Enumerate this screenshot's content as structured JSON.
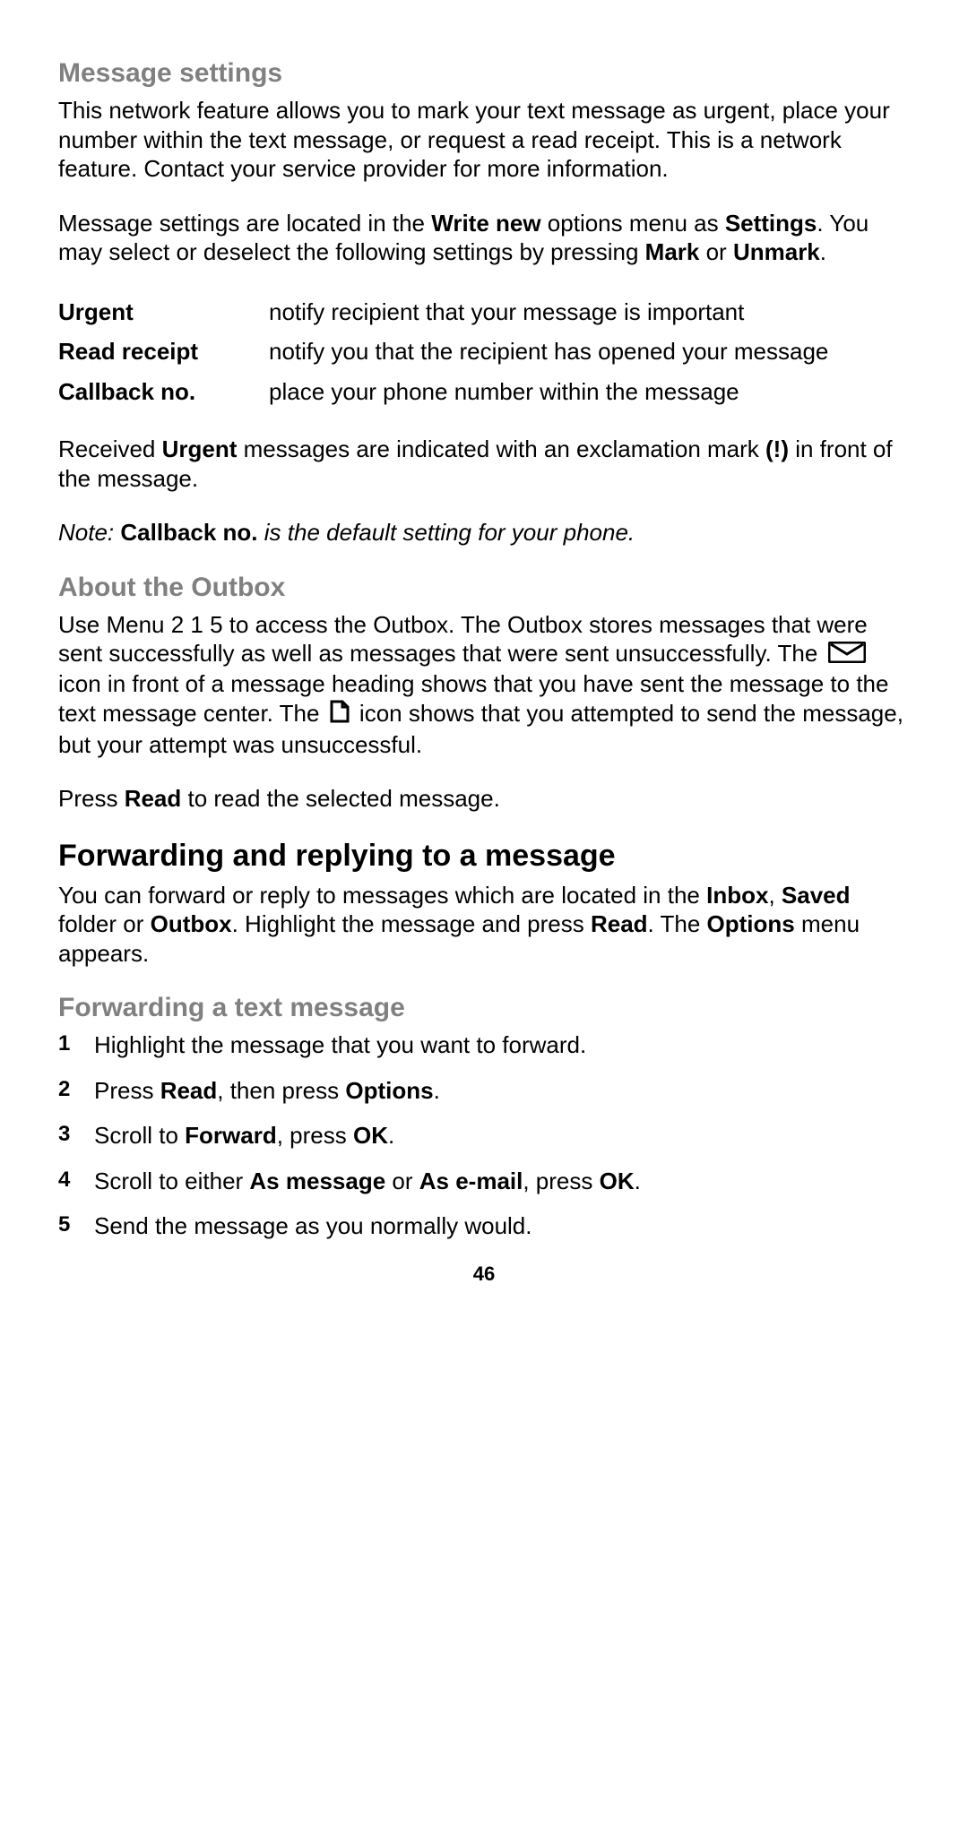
{
  "section1": {
    "heading": "Message settings",
    "p1": "This network feature allows you to mark your text message as urgent, place your number within the text message, or request a read receipt.  This is a network feature. Contact your service provider for more information.",
    "p2_pre": "Message settings are located in the ",
    "p2_b1": "Write new",
    "p2_mid1": " options menu as ",
    "p2_b2": "Settings",
    "p2_mid2": ". You may select or deselect the following settings by pressing ",
    "p2_b3": "Mark",
    "p2_mid3": " or ",
    "p2_b4": "Unmark",
    "p2_end": ".",
    "table": [
      {
        "term": "Urgent",
        "def": "notify recipient that your message is important"
      },
      {
        "term": "Read receipt",
        "def": "notify you that the recipient has opened your message"
      },
      {
        "term": "Callback no.",
        "def": "place your phone number within the message"
      }
    ],
    "p3_pre": "Received ",
    "p3_b1": "Urgent",
    "p3_mid": " messages are indicated with an exclamation mark ",
    "p3_paren": "(!)",
    "p3_end": " in front of the message.",
    "note_prefix": "Note: ",
    "note_bold": "Callback no.",
    "note_rest": " is the default setting for your phone."
  },
  "section2": {
    "heading": "About the Outbox",
    "p1_a": "Use Menu 2 1 5 to access the Outbox. The Outbox stores messages that were sent successfully as well as messages that were sent unsuccessfully. The ",
    "p1_b": " icon in front of a message heading shows that you have sent the message to the text message center. The ",
    "p1_c": " icon shows that you attempted to send the message, but your attempt was unsuccessful.",
    "p2_pre": "Press ",
    "p2_b": "Read",
    "p2_end": " to read the selected message."
  },
  "section3": {
    "heading": "Forwarding and replying to a message",
    "p1_pre": "You can forward or reply to messages which are located in the ",
    "p1_b1": "Inbox",
    "p1_m1": ", ",
    "p1_b2": "Saved",
    "p1_m2": " folder or ",
    "p1_b3": "Outbox",
    "p1_m3": ".  Highlight the message and press ",
    "p1_b4": "Read",
    "p1_m4": ". The ",
    "p1_b5": "Options",
    "p1_end": " menu appears."
  },
  "section4": {
    "heading": "Forwarding a text message",
    "steps": {
      "s1": "Highlight the message that you want to forward.",
      "s2_pre": "Press ",
      "s2_b1": "Read",
      "s2_mid": ", then press ",
      "s2_b2": "Options",
      "s2_end": ".",
      "s3_pre": "Scroll to ",
      "s3_b1": "Forward",
      "s3_mid": ", press ",
      "s3_b2": "OK",
      "s3_end": ".",
      "s4_pre": "Scroll to either ",
      "s4_b1": "As message",
      "s4_mid": " or ",
      "s4_b2": "As e-mail",
      "s4_mid2": ", press ",
      "s4_b3": "OK",
      "s4_end": ".",
      "s5": "Send the message as you normally would."
    }
  },
  "page_number": "46"
}
